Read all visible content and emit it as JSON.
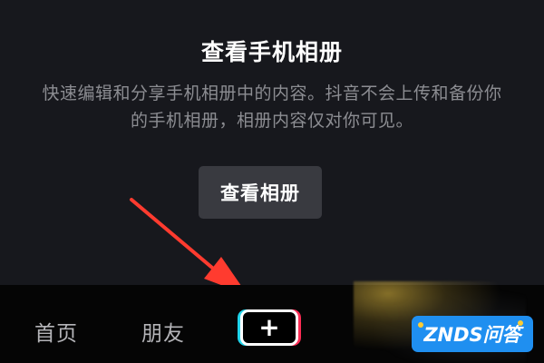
{
  "album_prompt": {
    "title": "查看手机相册",
    "description": "快速编辑和分享手机相册中的内容。抖音不会上传和备份你的手机相册，相册内容仅对你可见。",
    "button_label": "查看相册"
  },
  "bottom_nav": {
    "items": [
      {
        "label": "首页"
      },
      {
        "label": "朋友"
      }
    ],
    "create_icon": "+"
  },
  "watermark": {
    "text": "ZNDS问答"
  },
  "colors": {
    "background": "#17181d",
    "nav_background": "#050505",
    "button_background": "#393a40",
    "arrow": "#ff3b2f",
    "accent_cyan": "#20d5ec",
    "accent_red": "#fe2c55",
    "watermark_background": "#1f8ff0"
  },
  "icons": {
    "arrow": "red-arrow-icon",
    "create": "plus-icon"
  }
}
